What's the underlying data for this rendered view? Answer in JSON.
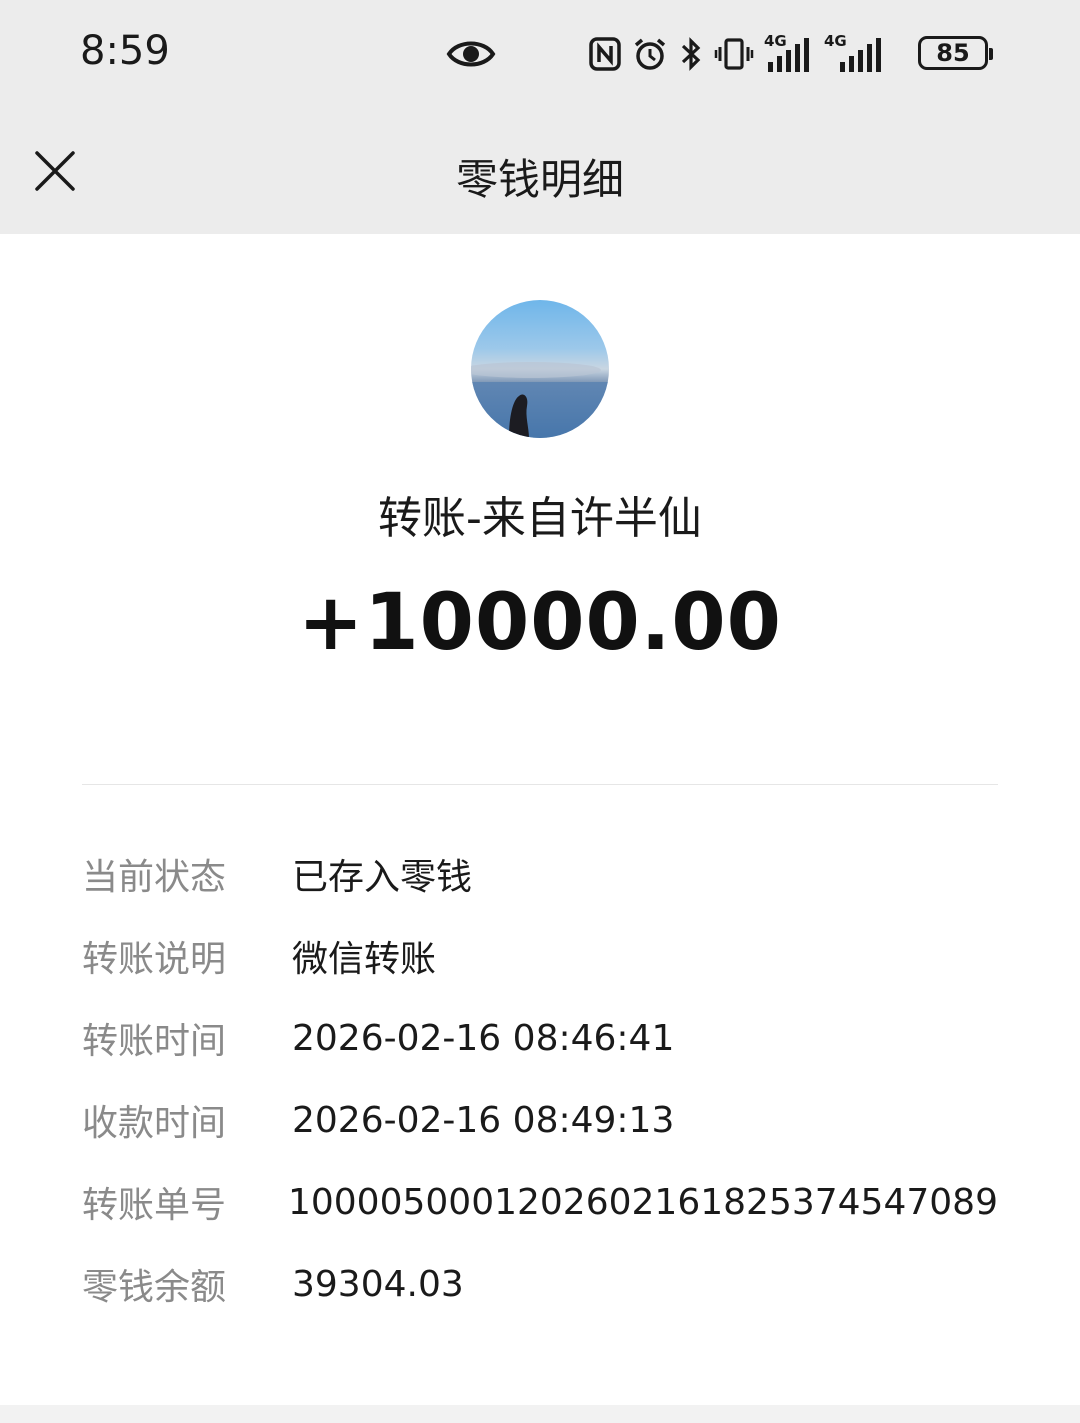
{
  "status_bar": {
    "time": "8:59",
    "icons": [
      "eye-icon",
      "nfc-icon",
      "alarm-icon",
      "bluetooth-icon",
      "vibrate-icon",
      "signal-4g-icon",
      "signal-4g-icon"
    ],
    "network_1": "4G",
    "network_2": "4G",
    "battery": "85"
  },
  "nav": {
    "title": "零钱明细",
    "close_icon": "close-icon"
  },
  "transaction": {
    "title": "转账-来自许半仙",
    "amount": "+10000.00",
    "details": [
      {
        "label": "当前状态",
        "value": "已存入零钱"
      },
      {
        "label": "转账说明",
        "value": "微信转账"
      },
      {
        "label": "转账时间",
        "value": "2026-02-16 08:46:41"
      },
      {
        "label": "收款时间",
        "value": "2026-02-16 08:49:13"
      },
      {
        "label": "转账单号",
        "value": "1000050001202602161825374547089"
      },
      {
        "label": "零钱余额",
        "value": "39304.03"
      }
    ]
  }
}
